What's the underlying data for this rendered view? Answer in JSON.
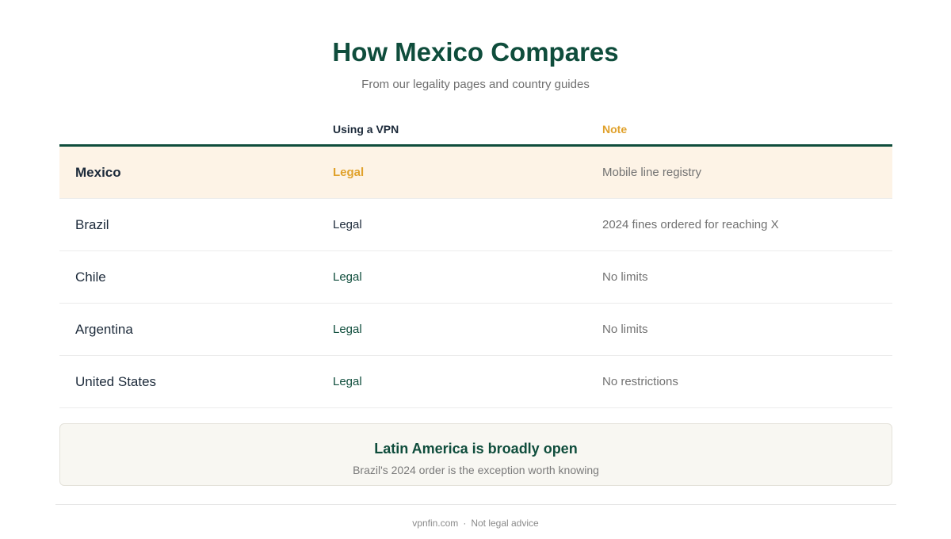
{
  "header": {
    "title": "How Mexico Compares",
    "subtitle": "From our legality pages and country guides"
  },
  "table": {
    "columns": [
      "",
      "Using a VPN",
      "Note"
    ],
    "rows": [
      {
        "country": "Mexico",
        "status": "Legal",
        "note": "Mobile line registry"
      },
      {
        "country": "Brazil",
        "status": "Legal",
        "note": "2024 fines ordered for reaching X"
      },
      {
        "country": "Chile",
        "status": "Legal",
        "note": "No limits"
      },
      {
        "country": "Argentina",
        "status": "Legal",
        "note": "No limits"
      },
      {
        "country": "United States",
        "status": "Legal",
        "note": "No restrictions"
      }
    ]
  },
  "callout": {
    "title": "Latin America is broadly open",
    "subtitle": "Brazil's 2024 order is the exception worth knowing"
  },
  "footer": {
    "site": "vpnfin.com",
    "separator": "·",
    "disclaimer": "Not legal advice"
  },
  "colors": {
    "brand_green": "#0f4d3c",
    "accent_amber": "#e0a12b",
    "highlight_bg": "#fdf3e6"
  }
}
